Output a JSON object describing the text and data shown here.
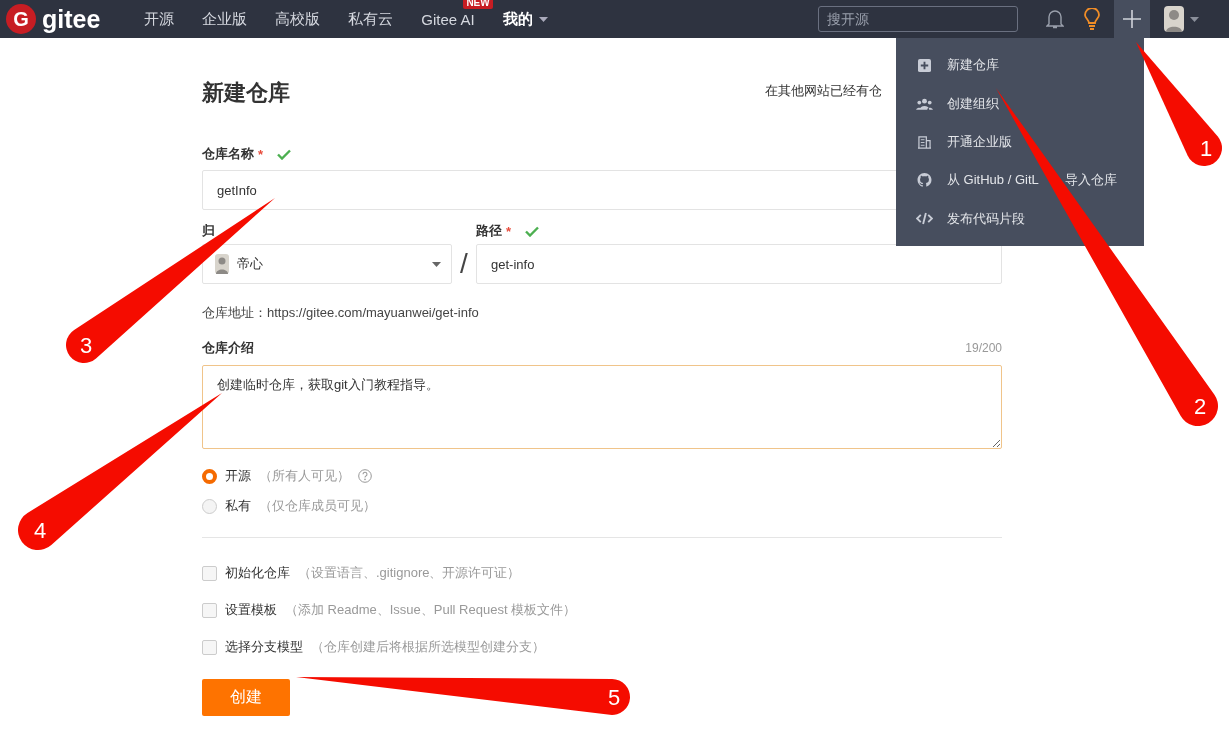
{
  "header": {
    "logo": {
      "mark": "G",
      "text": "gitee"
    },
    "nav": [
      {
        "label": "开源",
        "kind": "link"
      },
      {
        "label": "企业版",
        "kind": "link"
      },
      {
        "label": "高校版",
        "kind": "link"
      },
      {
        "label": "私有云",
        "kind": "link"
      },
      {
        "label": "Gitee AI",
        "kind": "link",
        "badge": "NEW"
      },
      {
        "label": "我的",
        "kind": "dropdown"
      }
    ],
    "search": {
      "placeholder": "搜开源"
    }
  },
  "create_menu": {
    "open": true,
    "items": [
      {
        "label": "新建仓库"
      },
      {
        "label": "创建组织"
      },
      {
        "label": "开通企业版"
      },
      {
        "label": "从 GitHub / GitL",
        "label_after": "导入仓库"
      },
      {
        "label": "发布代码片段"
      }
    ]
  },
  "form": {
    "title": "新建仓库",
    "import_hint": "在其他网站已经有仓",
    "name": {
      "label": "仓库名称",
      "required": "*",
      "valid": true,
      "value": "getInfo"
    },
    "owner": {
      "label": "归",
      "value": "帝心"
    },
    "separator": "/",
    "path": {
      "label": "路径",
      "required": "*",
      "valid": true,
      "value": "get-info"
    },
    "address": "仓库地址：https://gitee.com/mayuanwei/get-info",
    "description": {
      "label": "仓库介绍",
      "counter": "19/200",
      "value": "创建临时仓库，获取git入门教程指导。"
    },
    "visibility": [
      {
        "label": "开源",
        "hint": "（所有人可见）",
        "help_icon": true,
        "selected": true
      },
      {
        "label": "私有",
        "hint": "（仅仓库成员可见）",
        "help_icon": false,
        "selected": false
      }
    ],
    "options": [
      {
        "label": "初始化仓库",
        "hint": "（设置语言、.gitignore、开源许可证）",
        "checked": false
      },
      {
        "label": "设置模板",
        "hint": "（添加 Readme、Issue、Pull Request 模板文件）",
        "checked": false
      },
      {
        "label": "选择分支模型",
        "hint": "（仓库创建后将根据所选模型创建分支）",
        "checked": false
      }
    ],
    "submit": "创建"
  },
  "callouts": [
    {
      "number": "1"
    },
    {
      "number": "2"
    },
    {
      "number": "3"
    },
    {
      "number": "4"
    },
    {
      "number": "5"
    }
  ]
}
